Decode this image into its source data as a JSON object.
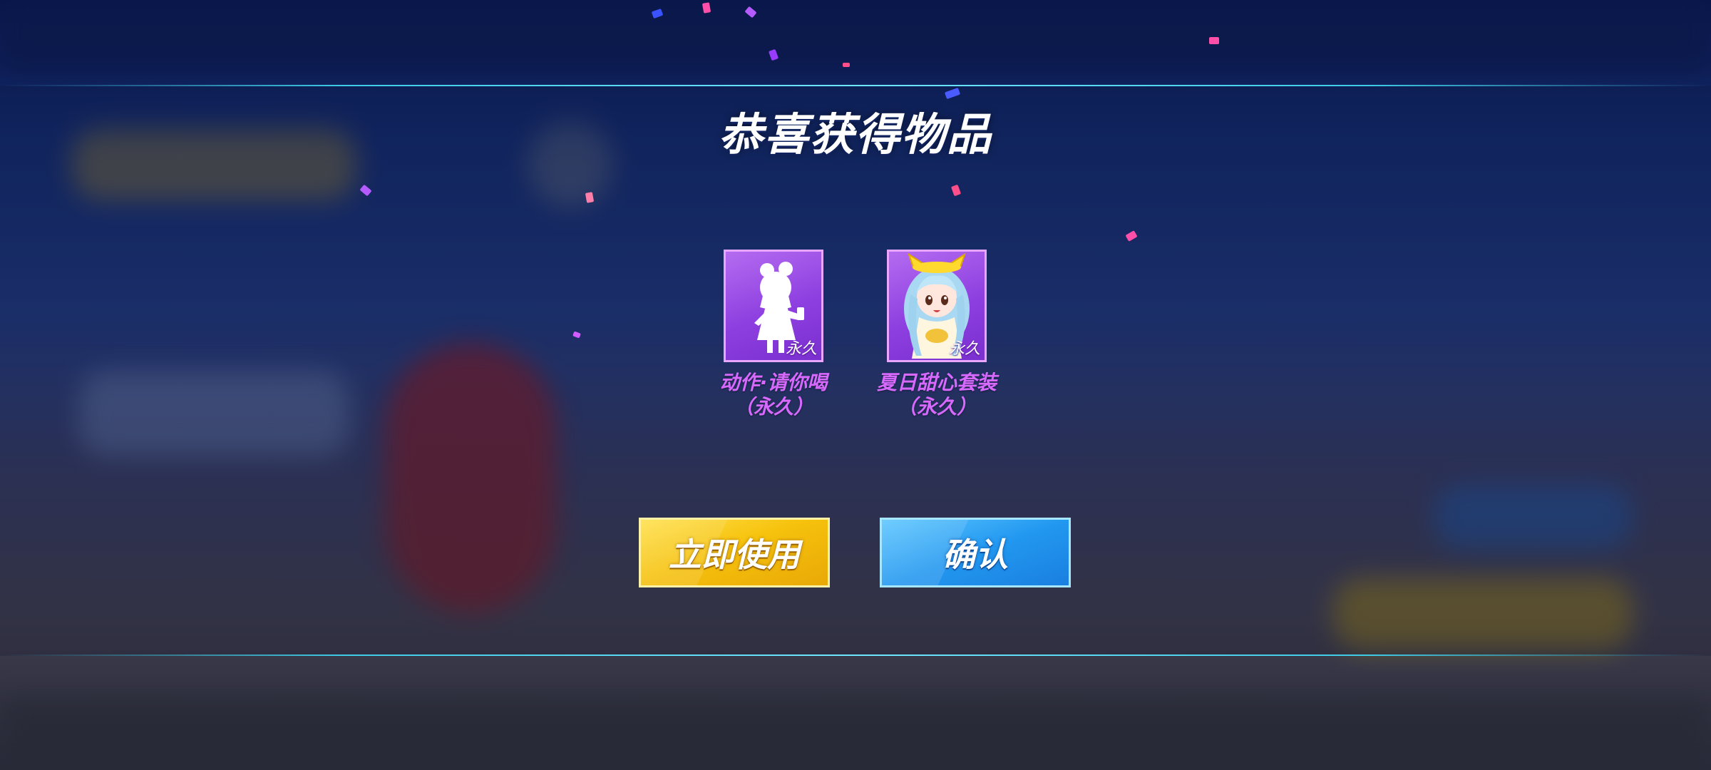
{
  "dialog": {
    "title": "恭喜获得物品",
    "items": [
      {
        "name_line1": "动作·请你喝",
        "name_line2": "（永久）",
        "tag": "永久",
        "icon": "silhouette-girl-drink-icon"
      },
      {
        "name_line1": "夏日甜心套装",
        "name_line2": "（永久）",
        "tag": "永久",
        "icon": "blue-hair-girl-avatar-icon"
      }
    ],
    "buttons": {
      "use_now": "立即使用",
      "confirm": "确认"
    }
  },
  "colors": {
    "item_name": "#d869ff",
    "card_bg": "#9a4ce6",
    "use_button": "#f6c20d",
    "confirm_button": "#2298f0",
    "band_line": "#3ecbe6"
  }
}
